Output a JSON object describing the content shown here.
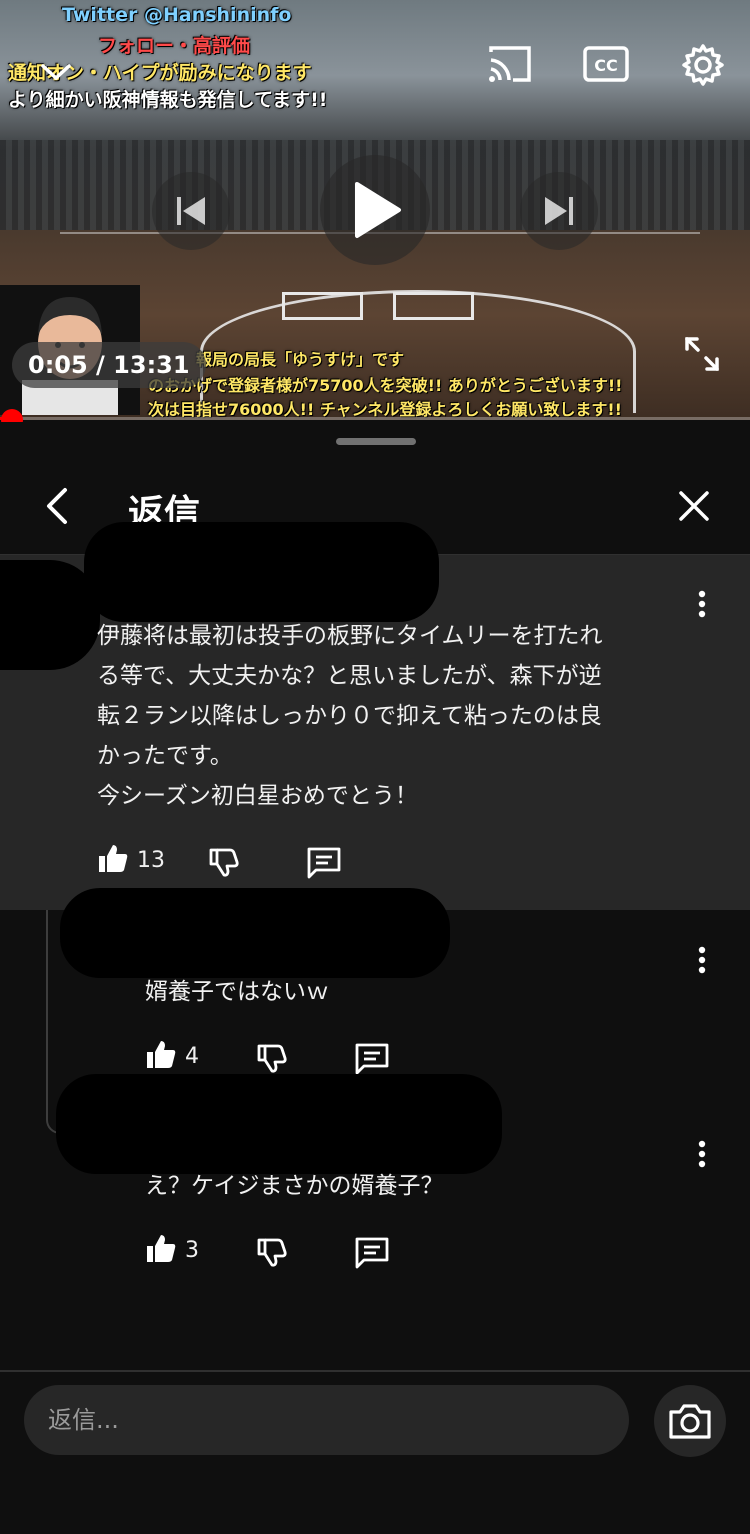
{
  "player": {
    "overlay_top": [
      "Twitter @Hanshininfo",
      "フォロー・高評価",
      "通知オン・ハイプが励みになります",
      "より細かい阪神情報も発信してます!!"
    ],
    "overlay_bottom": [
      "報局の局長「ゆうすけ」です",
      "のおかげで登録者様が75700人を突破!! ありがとうございます!!",
      "次は目指せ76000人!! チャンネル登録よろしくお願い致します!!"
    ],
    "time_display": "0:05 / 13:31",
    "progress": 0.006,
    "icons": {
      "minimize": "chevron-down-icon",
      "cast": "cast-icon",
      "captions": "cc-icon",
      "settings": "gear-icon",
      "previous": "skip-previous-icon",
      "play": "play-icon",
      "next": "skip-next-icon",
      "fullscreen": "fullscreen-icon"
    },
    "captions_label": "CC"
  },
  "panel": {
    "title": "返信",
    "comments": [
      {
        "text_lines": [
          "伊藤将は最初は投手の板野にタイムリーを打たれ",
          "る等で、大丈夫かな？と思いましたが、森下が逆",
          "転２ラン以降はしっかり０で抑えて粘ったのは良",
          "かったです。",
          "今シーズン初白星おめでとう！"
        ],
        "likes": "13"
      },
      {
        "text": "婿養子ではないｗ",
        "likes": "4"
      },
      {
        "text": "え？ケイジまさかの婿養子？",
        "likes": "3"
      }
    ],
    "reply_placeholder": "返信..."
  },
  "colors": {
    "background": "#0f0f0f",
    "highlight": "#272727",
    "progress": "#ff0000",
    "text": "#f1f1f1"
  }
}
